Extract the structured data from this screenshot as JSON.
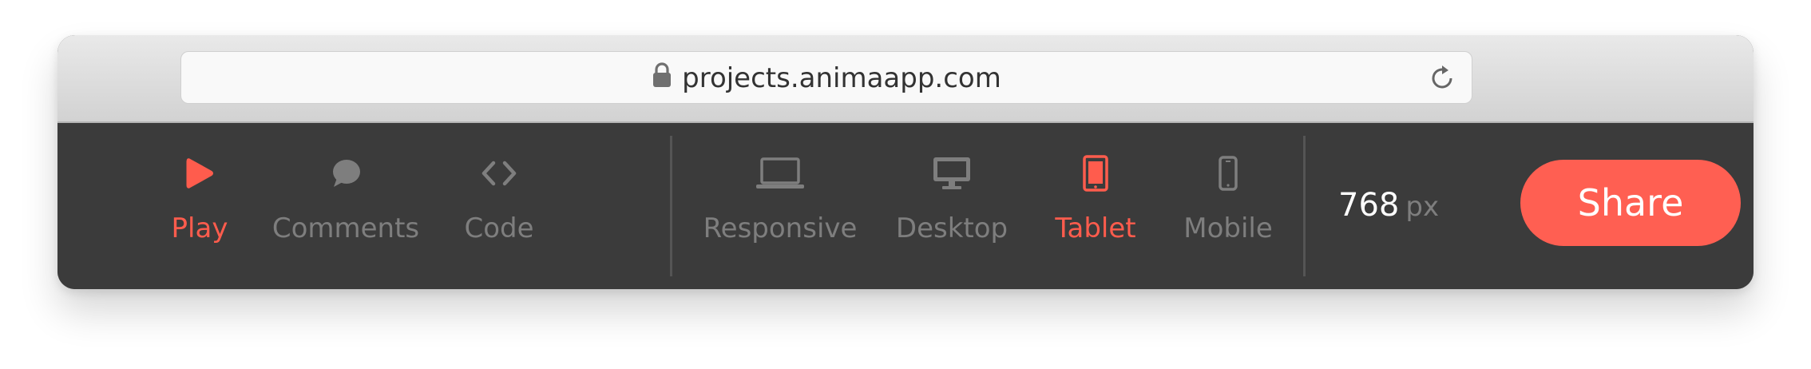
{
  "browser": {
    "url": "projects.animaapp.com",
    "icons": {
      "lock": "lock-icon",
      "reload": "reload-icon"
    }
  },
  "toolbar": {
    "modes": [
      {
        "label": "Play",
        "icon": "play-icon",
        "active": true
      },
      {
        "label": "Comments",
        "icon": "comment-icon",
        "active": false
      },
      {
        "label": "Code",
        "icon": "code-icon",
        "active": false
      }
    ],
    "devices": [
      {
        "label": "Responsive",
        "icon": "laptop-icon",
        "active": false
      },
      {
        "label": "Desktop",
        "icon": "desktop-icon",
        "active": false
      },
      {
        "label": "Tablet",
        "icon": "tablet-icon",
        "active": true
      },
      {
        "label": "Mobile",
        "icon": "mobile-icon",
        "active": false
      }
    ],
    "width": {
      "value": "768",
      "unit": "px"
    },
    "share_label": "Share"
  },
  "colors": {
    "accent": "#ff5c4d",
    "toolbar_bg": "#3b3b3b",
    "inactive": "#7e7e7e",
    "share_bg": "#ff5f52"
  }
}
